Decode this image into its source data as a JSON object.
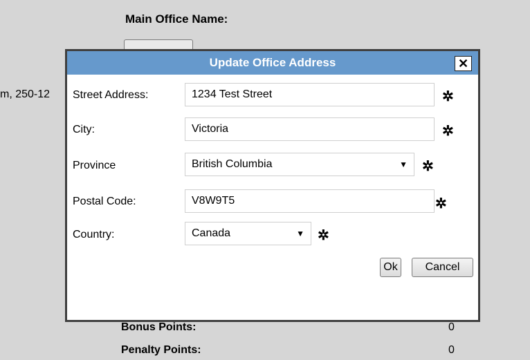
{
  "background": {
    "heading": "Main Office Name:",
    "phone_fragment": "m, 250-12",
    "rows": [
      {
        "label": "Bonus Points:",
        "value": "0"
      },
      {
        "label": "Penalty Points:",
        "value": "0"
      }
    ]
  },
  "dialog": {
    "title": "Update Office Address",
    "close_label": "✕",
    "required_marker": "✲",
    "fields": {
      "street": {
        "label": "Street Address:",
        "value": "1234 Test Street"
      },
      "city": {
        "label": "City:",
        "value": "Victoria"
      },
      "province": {
        "label": "Province",
        "value": "British Columbia"
      },
      "postal": {
        "label": "Postal Code:",
        "value": "V8W9T5"
      },
      "country": {
        "label": "Country:",
        "value": "Canada"
      }
    },
    "ok_label": "Ok",
    "cancel_label": "Cancel"
  },
  "colors": {
    "titlebar": "#6699cc",
    "page_background": "#d6d6d6"
  }
}
